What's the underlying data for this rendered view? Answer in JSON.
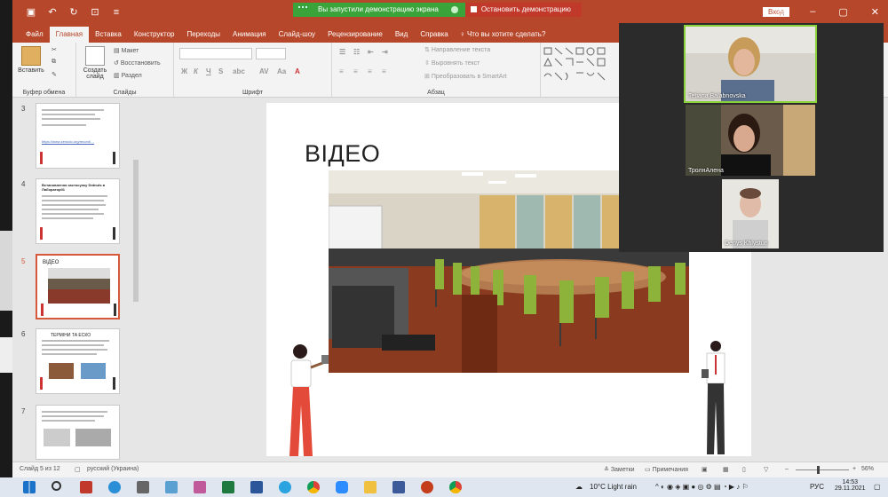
{
  "share_banner": {
    "status": "Вы запустили демонстрацию экрана",
    "stop": "Остановить демонстрацию"
  },
  "titlebar": {
    "signin": "Вход"
  },
  "tabs": [
    "Файл",
    "Главная",
    "Вставка",
    "Конструктор",
    "Переходы",
    "Анимация",
    "Слайд-шоу",
    "Рецензирование",
    "Вид",
    "Справка"
  ],
  "active_tab": "Главная",
  "tell_me": "Что вы хотите сделать?",
  "ribbon": {
    "clipboard": {
      "paste": "Вставить",
      "label": "Буфер обмена"
    },
    "slides": {
      "new_slide": "Создать слайд",
      "layout": "Макет",
      "reset": "Восстановить",
      "section": "Раздел",
      "label": "Слайды"
    },
    "font": {
      "label": "Шрифт"
    },
    "paragraph": {
      "text_direction": "Направление текста",
      "align_text": "Выровнять текст",
      "smartart": "Преобразовать в SmartArt",
      "label": "Абзац"
    }
  },
  "thumbnails": [
    {
      "num": "3",
      "heading": "",
      "link": "https://www.zenodo.org/record/…"
    },
    {
      "num": "4",
      "heading": "Встановлення застосунку Dotnuts в Лабораторії1",
      "link": ""
    },
    {
      "num": "5",
      "heading": "ВІДЕО",
      "link": ""
    },
    {
      "num": "6",
      "heading": "ТЕРМІНИ ТА ЕСКО",
      "link": ""
    },
    {
      "num": "7",
      "heading": "",
      "link": ""
    }
  ],
  "selected_slide": "5",
  "slide": {
    "title": "ВІДЕО"
  },
  "statusbar": {
    "slide_counter": "Слайд 5 из 12",
    "language": "русский (Украина)",
    "notes": "Заметки",
    "comments": "Примечания",
    "zoom": "56%"
  },
  "participants": [
    {
      "name": "Tetiana Balabnovska",
      "active": true
    },
    {
      "name": "ТролнАлена",
      "active": false
    },
    {
      "name": "Denys Khlystun",
      "active": false
    }
  ],
  "taskbar": {
    "weather": "10°C Light rain",
    "lang": "РУС",
    "time": "14:53",
    "date": "29.11.2021"
  },
  "colors": {
    "ppt_accent": "#b7472a",
    "share_green": "#3aa33a",
    "share_red": "#c0392b",
    "active_speaker": "#8bd23a"
  }
}
